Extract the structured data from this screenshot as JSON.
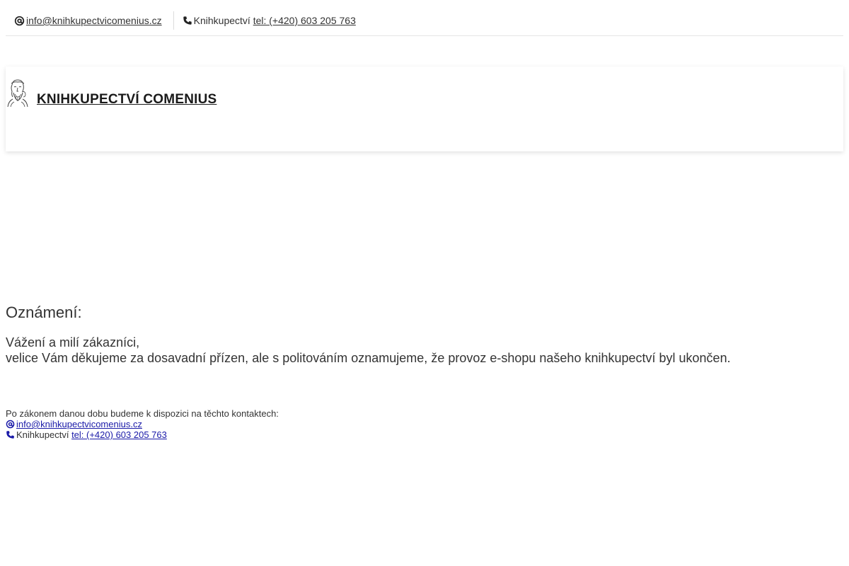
{
  "topbar": {
    "email": "info@knihkupectvicomenius.cz",
    "phone_prefix": "Knihkupectví",
    "phone_link": "tel: (+420) 603 205 763"
  },
  "header": {
    "brand_name": "KNIHKUPECTVÍ COMENIUS"
  },
  "announcement": {
    "title": "Oznámení:",
    "line1": "Vážení a milí zákazníci,",
    "line2": "velice Vám děkujeme za dosavadní přízen, ale s politováním oznamujeme, že provoz e-shopu našeho knihkupectví byl ukončen."
  },
  "contacts": {
    "intro": "Po zákonem danou dobu budeme k dispozici na těchto kontaktech:",
    "email": "info@knihkupectvicomenius.cz",
    "phone_prefix": "Knihkupectví",
    "phone_link": "tel: (+420) 603 205 763"
  },
  "icons": {
    "email": "at-sign-icon",
    "phone": "phone-icon",
    "logo": "comenius-portrait-logo"
  },
  "colors": {
    "link_dark": "#333333",
    "link_blue": "#1a1aa8",
    "divider": "#e6e6e6"
  }
}
